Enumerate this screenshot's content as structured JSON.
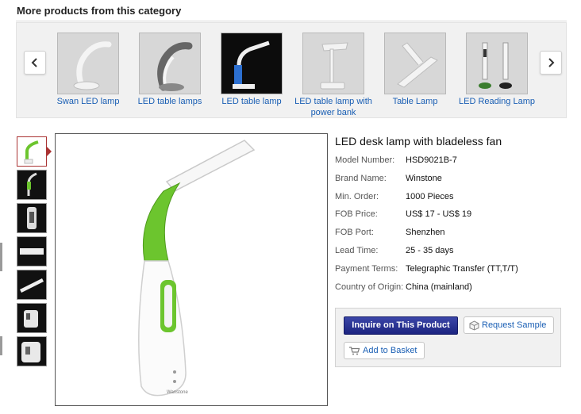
{
  "section_title": "More products from this category",
  "carousel": {
    "prev_icon": "chevron-left-icon",
    "next_icon": "chevron-right-icon",
    "items": [
      {
        "label": "Swan LED lamp"
      },
      {
        "label": "LED table lamps"
      },
      {
        "label": "LED table lamp"
      },
      {
        "label": "LED table lamp with power bank"
      },
      {
        "label": "Table Lamp"
      },
      {
        "label": "LED Reading Lamp"
      }
    ]
  },
  "gallery": {
    "thumb_count": 7,
    "selected_index": 0
  },
  "product": {
    "title": "LED desk lamp with bladeless fan",
    "specs": [
      {
        "label": "Model Number:",
        "value": "HSD9021B-7"
      },
      {
        "label": "Brand Name:",
        "value": "Winstone"
      },
      {
        "label": "Min. Order:",
        "value": "1000 Pieces"
      },
      {
        "label": "FOB Price:",
        "value": "US$ 17 - US$ 19"
      },
      {
        "label": "FOB Port:",
        "value": "Shenzhen"
      },
      {
        "label": "Lead Time:",
        "value": "25 - 35 days"
      },
      {
        "label": "Payment Terms:",
        "value": "Telegraphic Transfer (TT,T/T)"
      },
      {
        "label": "Country of Origin:",
        "value": "China (mainland)"
      }
    ]
  },
  "actions": {
    "inquire_label": "Inquire on This Product",
    "sample_label": "Request Sample",
    "basket_label": "Add to Basket"
  },
  "colors": {
    "accent_green": "#6cc52e",
    "link_blue": "#1a5fb4",
    "inquire_button": "#26308f"
  }
}
